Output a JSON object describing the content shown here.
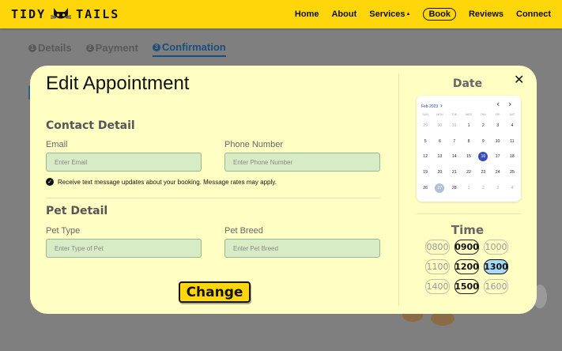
{
  "navbar": {
    "brand_left": "TIDY",
    "brand_right": "TAILS",
    "links": [
      "Home",
      "About",
      "Services",
      "Book",
      "Reviews",
      "Connect"
    ],
    "services_caret": "▲"
  },
  "steps": [
    {
      "num": "1",
      "label": "Details"
    },
    {
      "num": "2",
      "label": "Payment"
    },
    {
      "num": "3",
      "label": "Confirmation"
    }
  ],
  "modal": {
    "title": "Edit Appointment",
    "close_glyph": "✕",
    "contact_section": "Contact Detail",
    "email_label": "Email",
    "email_placeholder": "Enter Email",
    "phone_label": "Phone Number",
    "phone_placeholder": "Enter Phone Number",
    "sms_check_glyph": "✓",
    "sms_text": "Receive text message updates about your booking. Message rates may apply.",
    "pet_section": "Pet Detail",
    "pet_type_label": "Pet Type",
    "pet_type_placeholder": "Enter Type of Pet",
    "pet_breed_label": "Pet Breed",
    "pet_breed_placeholder": "Enter Pet Breed",
    "submit_label": "Change"
  },
  "date": {
    "title": "Date",
    "month_label": "Feb 2023",
    "month_chevron": "›",
    "prev_glyph": "‹",
    "next_glyph": "›",
    "weekdays": [
      "SUN",
      "MON",
      "TUE",
      "WED",
      "THU",
      "FRI",
      "SAT"
    ],
    "days": [
      [
        "29",
        "30",
        "31",
        "1",
        "2",
        "3",
        "4"
      ],
      [
        "5",
        "6",
        "7",
        "8",
        "9",
        "10",
        "11"
      ],
      [
        "12",
        "13",
        "14",
        "15",
        "16",
        "17",
        "18"
      ],
      [
        "19",
        "20",
        "21",
        "22",
        "23",
        "24",
        "25"
      ],
      [
        "26",
        "27",
        "28",
        "1",
        "2",
        "3",
        "4"
      ]
    ],
    "selected_day": "16",
    "today_day": "27"
  },
  "time": {
    "title": "Time",
    "slots": [
      {
        "label": "0800",
        "state": "unavailable"
      },
      {
        "label": "0900",
        "state": "available"
      },
      {
        "label": "1000",
        "state": "unavailable"
      },
      {
        "label": "1100",
        "state": "unavailable"
      },
      {
        "label": "1200",
        "state": "available"
      },
      {
        "label": "1300",
        "state": "selected"
      },
      {
        "label": "1400",
        "state": "unavailable"
      },
      {
        "label": "1500",
        "state": "available"
      },
      {
        "label": "1600",
        "state": "unavailable"
      }
    ]
  },
  "colors": {
    "nav_yellow": "#ffd60a",
    "modal_bg": "#ffffc4",
    "input_bg": "#d7ecc4",
    "selected_day": "#3b4bb5",
    "selected_slot": "#a6dcfa",
    "active_step": "#1c4e7c"
  }
}
